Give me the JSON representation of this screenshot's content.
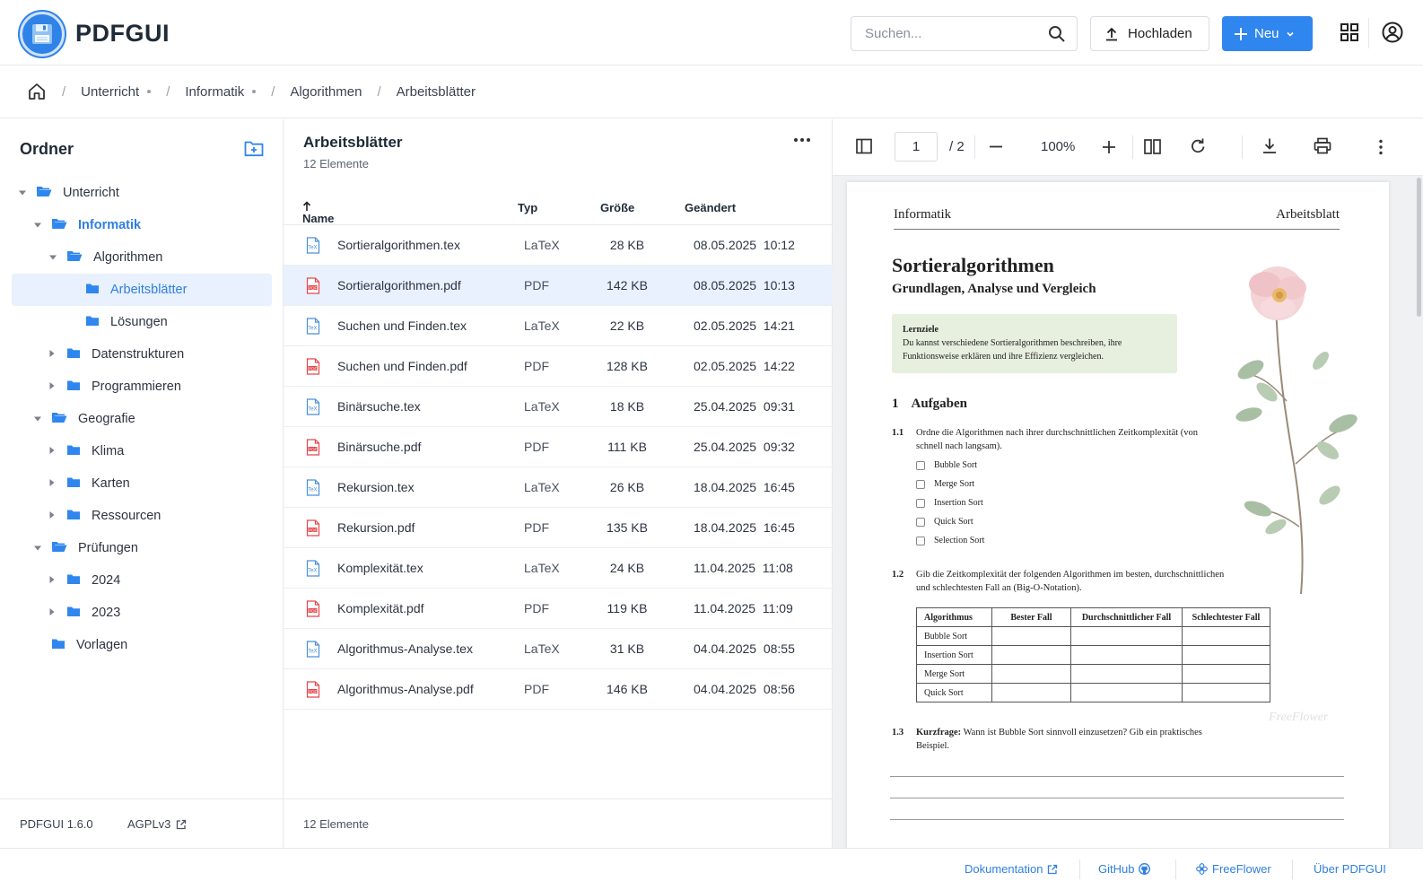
{
  "app": {
    "name": "PDFGUI",
    "version": "PDFGUI 1.6.0",
    "license": "AGPLv3"
  },
  "header": {
    "search_placeholder": "Suchen...",
    "upload_label": "Hochladen",
    "new_label": "Neu"
  },
  "breadcrumb": {
    "items": [
      "Unterricht",
      "Informatik",
      "Algorithmen",
      "Arbeitsblätter"
    ]
  },
  "sidebar": {
    "title": "Ordner",
    "tree": [
      {
        "label": "Unterricht",
        "depth": 0,
        "expanded": true,
        "state": "normal"
      },
      {
        "label": "Informatik",
        "depth": 1,
        "expanded": true,
        "state": "bold"
      },
      {
        "label": "Algorithmen",
        "depth": 2,
        "expanded": true,
        "state": "normal"
      },
      {
        "label": "Arbeitsblätter",
        "depth": 3,
        "expanded": null,
        "state": "active"
      },
      {
        "label": "Lösungen",
        "depth": 3,
        "expanded": null,
        "state": "normal"
      },
      {
        "label": "Datenstrukturen",
        "depth": 2,
        "expanded": false,
        "state": "normal"
      },
      {
        "label": "Programmieren",
        "depth": 2,
        "expanded": false,
        "state": "normal"
      },
      {
        "label": "Geografie",
        "depth": 1,
        "expanded": true,
        "state": "normal"
      },
      {
        "label": "Klima",
        "depth": 2,
        "expanded": false,
        "state": "normal"
      },
      {
        "label": "Karten",
        "depth": 2,
        "expanded": false,
        "state": "normal"
      },
      {
        "label": "Ressourcen",
        "depth": 2,
        "expanded": false,
        "state": "normal"
      },
      {
        "label": "Prüfungen",
        "depth": 1,
        "expanded": true,
        "state": "normal"
      },
      {
        "label": "2024",
        "depth": 2,
        "expanded": false,
        "state": "normal"
      },
      {
        "label": "2023",
        "depth": 2,
        "expanded": false,
        "state": "normal"
      },
      {
        "label": "Vorlagen",
        "depth": 1,
        "expanded": null,
        "state": "normal"
      }
    ]
  },
  "filelist": {
    "title": "Arbeitsblätter",
    "count": "12 Elemente",
    "footer_count": "12 Elemente",
    "columns": {
      "name": "Name",
      "type": "Typ",
      "size": "Größe",
      "modified": "Geändert"
    },
    "files": [
      {
        "name": "Sortieralgorithmen.tex",
        "type": "LaTeX",
        "size": "28 KB",
        "modified": "08.05.2025  10:12",
        "kind": "tex"
      },
      {
        "name": "Sortieralgorithmen.pdf",
        "type": "PDF",
        "size": "142 KB",
        "modified": "08.05.2025  10:13",
        "kind": "pdf",
        "selected": true
      },
      {
        "name": "Suchen und Finden.tex",
        "type": "LaTeX",
        "size": "22 KB",
        "modified": "02.05.2025  14:21",
        "kind": "tex"
      },
      {
        "name": "Suchen und Finden.pdf",
        "type": "PDF",
        "size": "128 KB",
        "modified": "02.05.2025  14:22",
        "kind": "pdf"
      },
      {
        "name": "Binärsuche.tex",
        "type": "LaTeX",
        "size": "18 KB",
        "modified": "25.04.2025  09:31",
        "kind": "tex"
      },
      {
        "name": "Binärsuche.pdf",
        "type": "PDF",
        "size": "111 KB",
        "modified": "25.04.2025  09:32",
        "kind": "pdf"
      },
      {
        "name": "Rekursion.tex",
        "type": "LaTeX",
        "size": "26 KB",
        "modified": "18.04.2025  16:45",
        "kind": "tex"
      },
      {
        "name": "Rekursion.pdf",
        "type": "PDF",
        "size": "135 KB",
        "modified": "18.04.2025  16:45",
        "kind": "pdf"
      },
      {
        "name": "Komplexität.tex",
        "type": "LaTeX",
        "size": "24 KB",
        "modified": "11.04.2025  11:08",
        "kind": "tex"
      },
      {
        "name": "Komplexität.pdf",
        "type": "PDF",
        "size": "119 KB",
        "modified": "11.04.2025  11:09",
        "kind": "pdf"
      },
      {
        "name": "Algorithmus-Analyse.tex",
        "type": "LaTeX",
        "size": "31 KB",
        "modified": "04.04.2025  08:55",
        "kind": "tex"
      },
      {
        "name": "Algorithmus-Analyse.pdf",
        "type": "PDF",
        "size": "146 KB",
        "modified": "04.04.2025  08:56",
        "kind": "pdf"
      }
    ]
  },
  "viewer": {
    "page": "1",
    "page_total": "/ 2",
    "zoom": "100%"
  },
  "document": {
    "header_left": "Informatik",
    "header_right": "Arbeitsblatt",
    "title": "Sortieralgorithmen",
    "subtitle": "Grundlagen, Analyse und Vergleich",
    "goal_title": "Lernziele",
    "goal_text": "Du kannst verschiedene Sortieralgorithmen beschreiben, ihre Funktionsweise erklären und ihre Effizienz vergleichen.",
    "section_num": "1",
    "section_title": "Aufgaben",
    "q1_num": "1.1",
    "q1_text": "Ordne die Algorithmen nach ihrer durchschnittlichen Zeitkomplexität (von schnell nach langsam).",
    "q1_options": [
      "Bubble Sort",
      "Merge Sort",
      "Insertion Sort",
      "Quick Sort",
      "Selection Sort"
    ],
    "q2_num": "1.2",
    "q2_text": "Gib die Zeitkomplexität der folgenden Algorithmen im besten, durchschnittlichen und schlechtesten Fall an (Big-O-Notation).",
    "table_head": [
      "Algorithmus",
      "Bester Fall",
      "Durchschnittlicher Fall",
      "Schlechtester Fall"
    ],
    "table_rows": [
      "Bubble Sort",
      "Insertion Sort",
      "Merge Sort",
      "Quick Sort"
    ],
    "q3_num": "1.3",
    "q3_bold": "Kurzfrage:",
    "q3_text": " Wann ist Bubble Sort sinnvoll einzusetzen? Gib ein praktisches Beispiel.",
    "watermark": "FreeFlower"
  },
  "footer": {
    "docs": "Dokumentation",
    "github": "GitHub",
    "freeflower": "FreeFlower",
    "about": "Über PDFGUI"
  },
  "colors": {
    "accent": "#2f86ee",
    "selected_bg": "#e8f1fd",
    "pdf_icon": "#e5484d",
    "tex_icon": "#4a90d9"
  }
}
